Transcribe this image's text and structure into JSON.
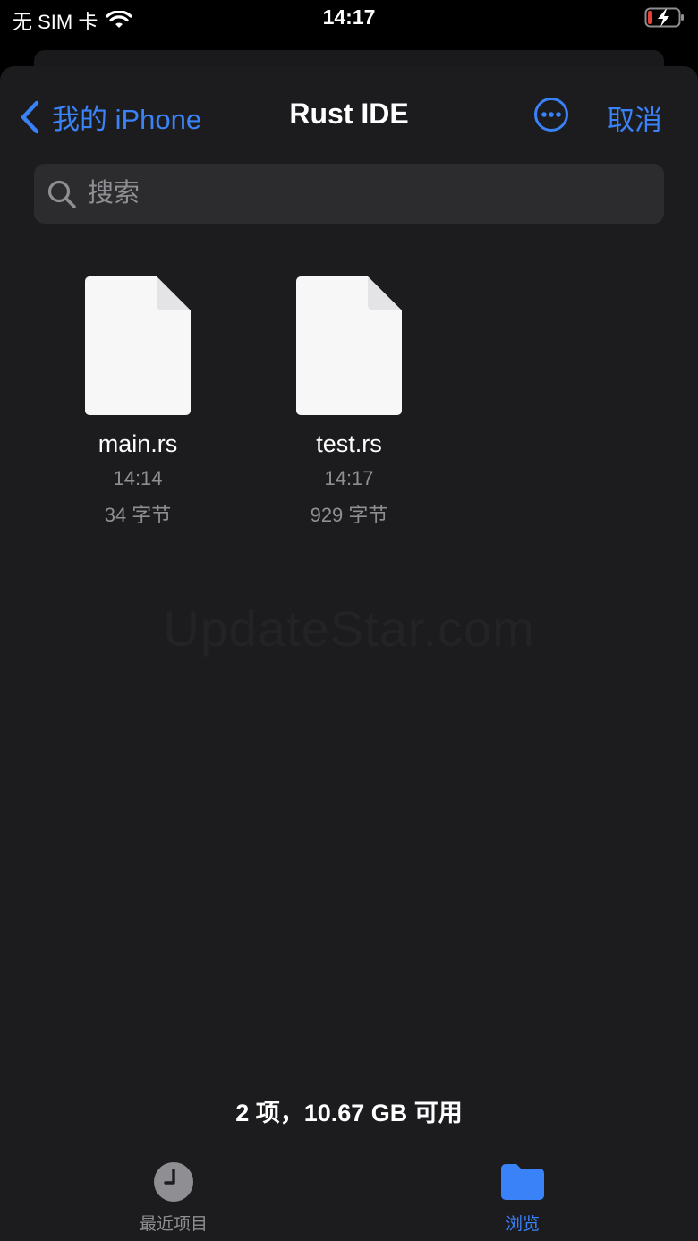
{
  "status": {
    "carrier": "无 SIM 卡",
    "time": "14:17",
    "wifi_icon": "wifi-icon",
    "battery_icon": "battery-charging-icon",
    "battery_color": "#e5423b"
  },
  "nav": {
    "back_label": "我的 iPhone",
    "title": "Rust IDE",
    "more_icon": "ellipsis-circle-icon",
    "cancel_label": "取消"
  },
  "search": {
    "placeholder": "搜索"
  },
  "files": [
    {
      "name": "main.rs",
      "time": "14:14",
      "size": "34 字节"
    },
    {
      "name": "test.rs",
      "time": "14:17",
      "size": "929 字节"
    }
  ],
  "watermark": "UpdateStar.com",
  "footer": {
    "summary": "2 项，10.67 GB 可用"
  },
  "tabs": [
    {
      "label": "最近项目",
      "icon": "clock-icon"
    },
    {
      "label": "浏览",
      "icon": "folder-icon"
    }
  ],
  "colors": {
    "accent": "#3a82f7",
    "inactive": "#8e8e93",
    "background": "#1c1c1e"
  }
}
